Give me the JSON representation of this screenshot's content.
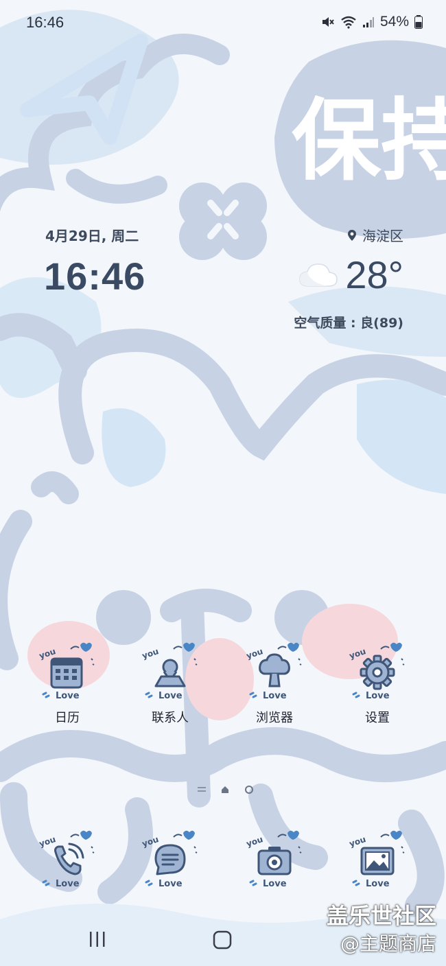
{
  "status_bar": {
    "time": "16:46",
    "battery": "54%",
    "icons": [
      "mute-icon",
      "wifi-icon",
      "signal-icon",
      "battery-icon"
    ]
  },
  "clock_widget": {
    "date": "4月29日, 周二",
    "time": "16:46"
  },
  "weather_widget": {
    "location": "海淀区",
    "temperature": "28°",
    "air_quality": "空气质量 : 良(89)",
    "icon": "cloud-icon"
  },
  "wallpaper": {
    "text": "保持"
  },
  "apps_row1": [
    {
      "label": "日历",
      "icon": "calendar-icon"
    },
    {
      "label": "联系人",
      "icon": "contacts-icon"
    },
    {
      "label": "浏览器",
      "icon": "browser-icon"
    },
    {
      "label": "设置",
      "icon": "gear-icon"
    }
  ],
  "dock": [
    {
      "icon": "phone-icon"
    },
    {
      "icon": "messages-icon"
    },
    {
      "icon": "camera-icon"
    },
    {
      "icon": "gallery-icon"
    }
  ],
  "icon_decoration": {
    "top": "you",
    "bottom": "Love"
  },
  "watermark": {
    "line1": "盖乐世社区",
    "line2": "@主题商店"
  },
  "colors": {
    "wallpaper_blue": "#c7d2e5",
    "wallpaper_light": "#d9eaf6",
    "pink": "#f6d8dc",
    "icon_stroke": "#3f5678",
    "icon_fill": "#9fb4d3",
    "heart": "#4a86c5"
  }
}
